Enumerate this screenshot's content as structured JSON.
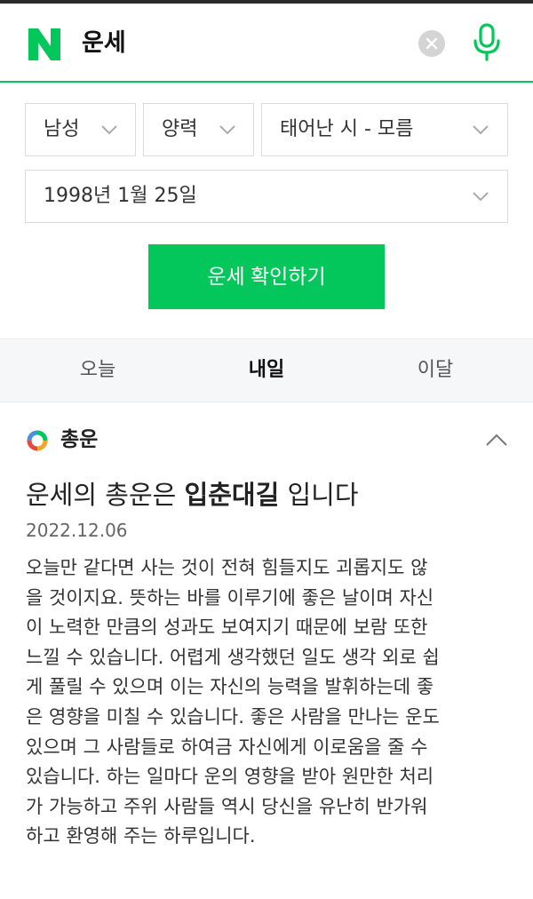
{
  "search": {
    "query": "운세",
    "logo_letter": "N"
  },
  "form": {
    "gender": "남성",
    "calendar": "양력",
    "birth_time": "태어난 시 - 모름",
    "birth_date": "1998년 1월 25일",
    "submit_label": "운세 확인하기"
  },
  "tabs": [
    {
      "label": "오늘"
    },
    {
      "label": "내일"
    },
    {
      "label": "이달"
    }
  ],
  "fortune": {
    "section_title": "총운",
    "headline_prefix": "운세의 총운은 ",
    "headline_keyword": "입춘대길",
    "headline_suffix": " 입니다",
    "date": "2022.12.06",
    "body_lines": [
      "오늘만 같다면 사는 것이 전혀 힘들지도 괴롭지도 않",
      "을 것이지요. 뜻하는 바를 이루기에 좋은 날이며 자신",
      "이 노력한 만큼의 성과도 보여지기 때문에 보람 또한",
      "느낄 수 있습니다. 어렵게 생각했던 일도 생각 외로 쉽",
      "게 풀릴 수 있으며 이는 자신의 능력을 발휘하는데 좋",
      "은 영향을 미칠 수 있습니다. 좋은 사람을 만나는 운도",
      "있으며 그 사람들로 하여금 자신에게 이로움을 줄 수",
      "있습니다. 하는 일마다 운의 영향을 받아 원만한 처리",
      "가 가능하고 주위 사람들 역시 당신을 유난히 반가워",
      "하고 환영해 주는 하루입니다."
    ]
  },
  "colors": {
    "brand_green": "#03c75a",
    "selected_tab": "내일"
  }
}
